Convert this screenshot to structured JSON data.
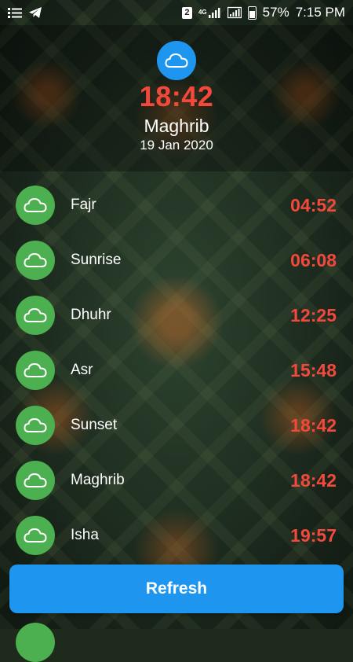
{
  "status_bar": {
    "sim_slot": "2",
    "network": "4G",
    "battery": "57%",
    "time": "7:15 PM",
    "icons": [
      "menu-icon",
      "telegram-icon",
      "sim-icon",
      "signal-icon",
      "battery-icon"
    ]
  },
  "header": {
    "icon": "cloud-icon",
    "time": "18:42",
    "prayer": "Maghrib",
    "date": "19 Jan 2020"
  },
  "prayers": [
    {
      "name": "Fajr",
      "time": "04:52",
      "icon": "cloud-icon"
    },
    {
      "name": "Sunrise",
      "time": "06:08",
      "icon": "cloud-icon"
    },
    {
      "name": "Dhuhr",
      "time": "12:25",
      "icon": "cloud-icon"
    },
    {
      "name": "Asr",
      "time": "15:48",
      "icon": "cloud-icon"
    },
    {
      "name": "Sunset",
      "time": "18:42",
      "icon": "cloud-icon"
    },
    {
      "name": "Maghrib",
      "time": "18:42",
      "icon": "cloud-icon"
    },
    {
      "name": "Isha",
      "time": "19:57",
      "icon": "cloud-icon"
    }
  ],
  "refresh_label": "Refresh",
  "colors": {
    "accent_blue": "#1e96f0",
    "time_red": "#f4483c",
    "avatar_green": "#4caf50"
  }
}
